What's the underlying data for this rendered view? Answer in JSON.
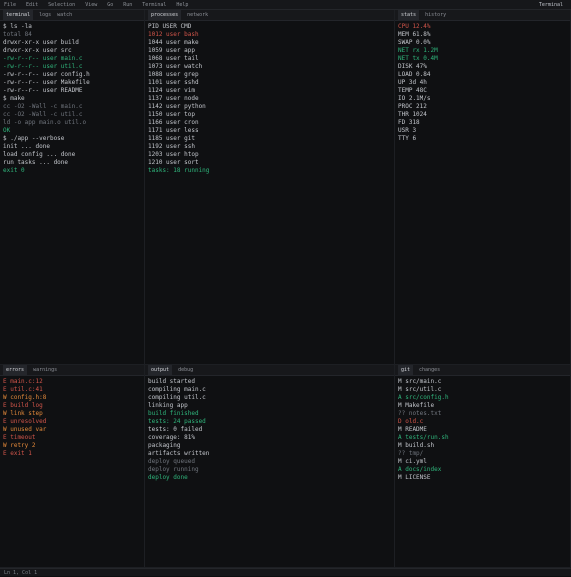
{
  "menubar": {
    "items": [
      "File",
      "Edit",
      "Selection",
      "View",
      "Go",
      "Run",
      "Terminal",
      "Help"
    ],
    "title": "Terminal"
  },
  "panes": {
    "top_left": {
      "tabs": [
        "terminal",
        "logs",
        "watch"
      ],
      "lines": [
        "$ ls -la",
        "total 84",
        "drwxr-xr-x  user  build",
        "drwxr-xr-x  user  src",
        "-rw-r--r--  user  main.c",
        "-rw-r--r--  user  util.c",
        "-rw-r--r--  user  config.h",
        "-rw-r--r--  user  Makefile",
        "-rw-r--r--  user  README",
        "$ make",
        "cc -O2 -Wall -c main.c",
        "cc -O2 -Wall -c util.c",
        "ld -o app main.o util.o",
        "OK",
        "$ ./app --verbose",
        "init ... done",
        "load config ... done",
        "run tasks ... done",
        "exit 0"
      ]
    },
    "top_mid": {
      "tabs": [
        "processes",
        "network"
      ],
      "lines": [
        "PID   USER   CMD",
        "1012  user   bash",
        "1044  user   make",
        "1059  user   app",
        "1068  user   tail",
        "1073  user   watch",
        "1088  user   grep",
        "1101  user   sshd",
        "1124  user   vim",
        "1137  user   node",
        "1142  user   python",
        "1150  user   top",
        "1166  user   cron",
        "1171  user   less",
        "1185  user   git",
        "1192  user   ssh",
        "1203  user   htop",
        "1210  user   sort"
      ],
      "summary": "tasks: 18 running"
    },
    "top_right": {
      "tabs": [
        "stats",
        "history"
      ],
      "lines": [
        "CPU 12.4%",
        "MEM 61.8%",
        "SWAP 0.0%",
        "NET rx 1.2M",
        "NET tx 0.4M",
        "DISK 47%",
        "LOAD 0.84",
        "UP 3d 4h",
        "TEMP 48C",
        "IO 2.1M/s",
        "PROC 212",
        "THR 1024",
        "FD 318",
        "USR 3",
        "TTY 6"
      ]
    },
    "bottom_left": {
      "tabs": [
        "errors",
        "warnings"
      ],
      "lines": [
        "E  main.c:12",
        "E  util.c:41",
        "W  config.h:8",
        "E  build log",
        "W  link step",
        "E  unresolved",
        "W  unused var",
        "E  timeout",
        "W  retry 2",
        "E  exit 1"
      ]
    },
    "bottom_mid": {
      "tabs": [
        "output",
        "debug"
      ],
      "lines": [
        "build started",
        "compiling main.c",
        "compiling util.c",
        "linking app",
        "build finished",
        "tests: 24 passed",
        "tests: 0 failed",
        "coverage: 81%",
        "packaging",
        "artifacts written",
        "deploy queued",
        "deploy running",
        "deploy done"
      ]
    },
    "bottom_right": {
      "tabs": [
        "git",
        "changes"
      ],
      "lines": [
        "M  src/main.c",
        "M  src/util.c",
        "A  src/config.h",
        "M  Makefile",
        "?? notes.txt",
        "D  old.c",
        "M  README",
        "A  tests/run.sh",
        "M  build.sh",
        "?? tmp/",
        "M  ci.yml",
        "A  docs/index",
        "M  LICENSE"
      ]
    }
  },
  "status": "Ln 1, Col 1"
}
